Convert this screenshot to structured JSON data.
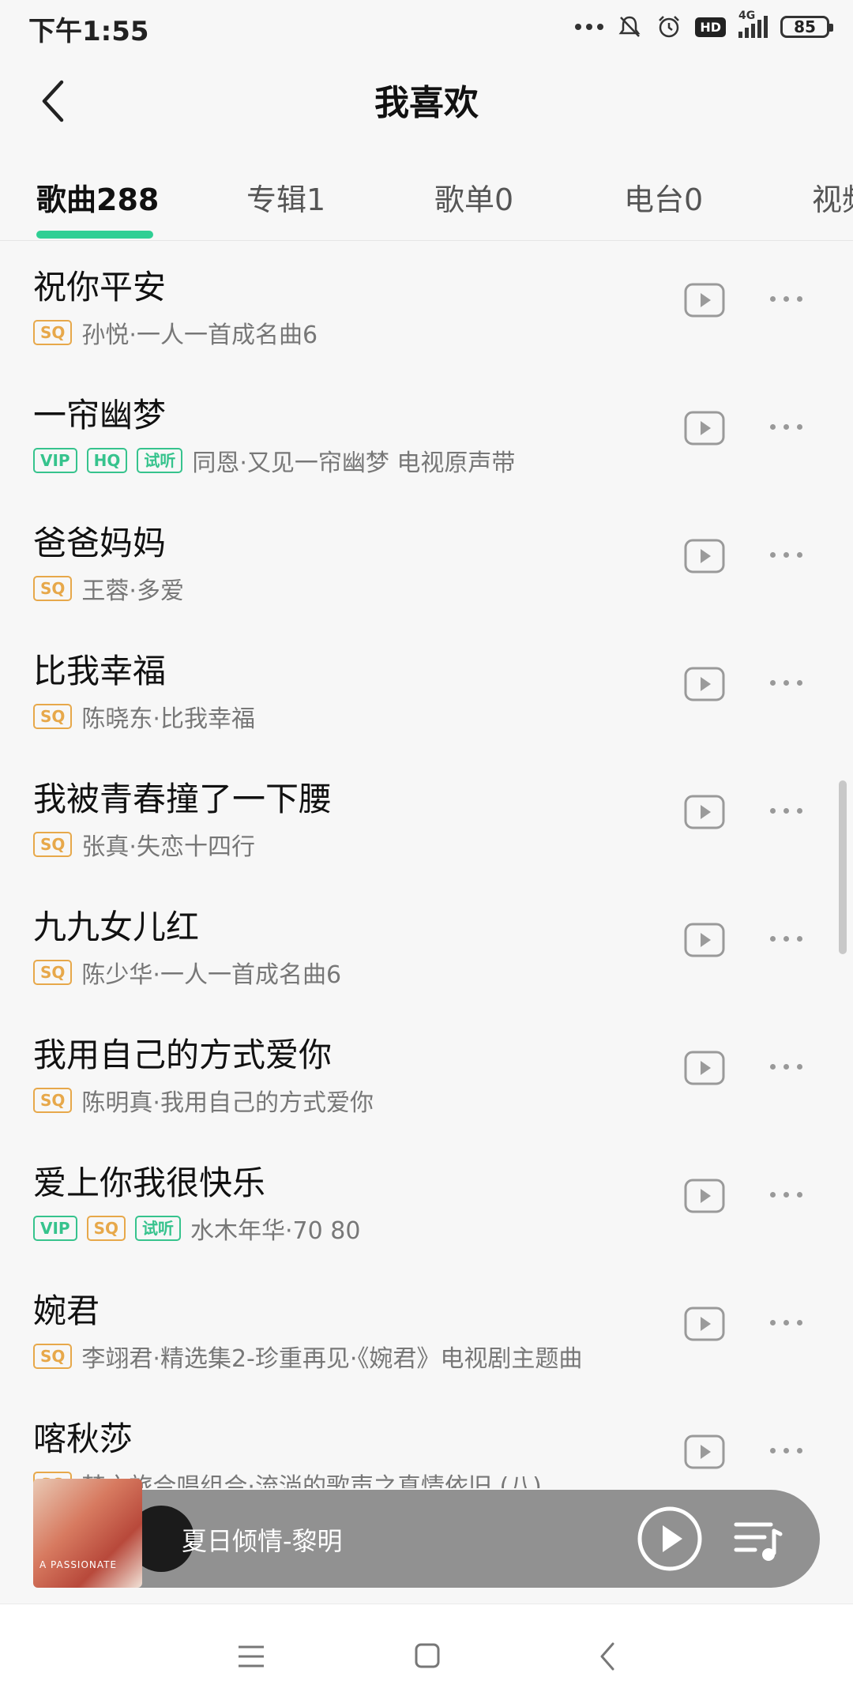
{
  "status_bar": {
    "time": "下午1:55",
    "network": "4G",
    "hd": "HD",
    "battery": "85"
  },
  "header": {
    "title": "我喜欢"
  },
  "tabs": [
    {
      "label": "歌曲288",
      "active": true
    },
    {
      "label": "专辑1",
      "active": false
    },
    {
      "label": "歌单0",
      "active": false
    },
    {
      "label": "电台0",
      "active": false
    },
    {
      "label": "视频",
      "active": false
    }
  ],
  "songs": [
    {
      "title": "祝你平安",
      "badges": [
        "SQ"
      ],
      "meta": "孙悦·一人一首成名曲6"
    },
    {
      "title": "一帘幽梦",
      "badges": [
        "VIP",
        "HQ",
        "试听"
      ],
      "meta": "同恩·又见一帘幽梦 电视原声带"
    },
    {
      "title": "爸爸妈妈",
      "badges": [
        "SQ"
      ],
      "meta": "王蓉·多爱"
    },
    {
      "title": "比我幸福",
      "badges": [
        "SQ"
      ],
      "meta": "陈晓东·比我幸福"
    },
    {
      "title": "我被青春撞了一下腰",
      "badges": [
        "SQ"
      ],
      "meta": "张真·失恋十四行"
    },
    {
      "title": "九九女儿红",
      "badges": [
        "SQ"
      ],
      "meta": "陈少华·一人一首成名曲6"
    },
    {
      "title": "我用自己的方式爱你",
      "badges": [
        "SQ"
      ],
      "meta": "陈明真·我用自己的方式爱你"
    },
    {
      "title": "爱上你我很快乐",
      "badges": [
        "VIP",
        "SQ",
        "试听"
      ],
      "meta": "水木年华·70 80"
    },
    {
      "title": "婉君",
      "badges": [
        "SQ"
      ],
      "meta": "李翊君·精选集2-珍重再见·《婉君》电视剧主题曲"
    },
    {
      "title": "喀秋莎",
      "badges": [
        "SQ"
      ],
      "meta": "梦之旅合唱组合·流淌的歌声之真情依旧 (八)"
    }
  ],
  "now_playing": {
    "text": "夏日倾情-黎明",
    "album_art_text": "A PASSIONATE"
  },
  "icons": {
    "back": "back-chevron-icon",
    "play": "play-video-icon",
    "more": "more-dots-icon",
    "playlist": "playlist-icon",
    "nav_menu": "menu-icon",
    "nav_home": "home-icon",
    "nav_back": "back-icon"
  },
  "colors": {
    "accent": "#2fcf94",
    "sq_badge": "#e7a84a",
    "green_badge": "#36c38d",
    "player_bg": "#919191"
  }
}
